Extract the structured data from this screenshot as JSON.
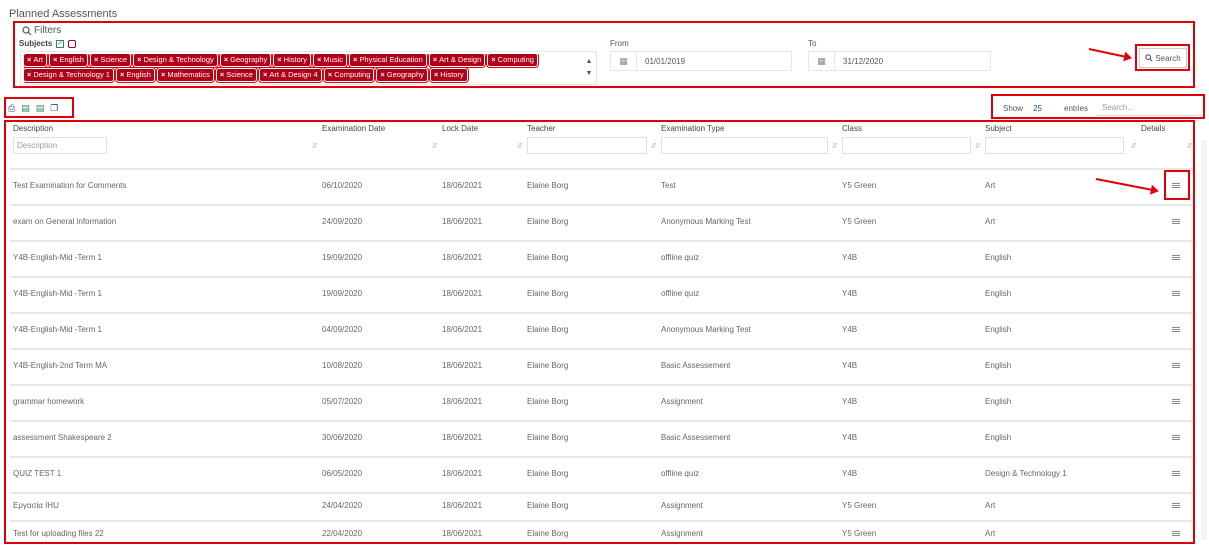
{
  "page": {
    "title": "Planned Assessments"
  },
  "filters": {
    "title": "Filters",
    "subjects_label": "Subjects",
    "tags": [
      "Art",
      "English",
      "Science",
      "Design & Technology",
      "Geography",
      "History",
      "Music",
      "Physical Education",
      "Art & Design",
      "Computing",
      "Design & Technology 1",
      "English",
      "Mathematics",
      "Science",
      "Art & Design 4",
      "Computing",
      "Geography",
      "History"
    ],
    "from_label": "From",
    "from_value": "01/01/2019",
    "to_label": "To",
    "to_value": "31/12/2020",
    "search_label": "Search"
  },
  "toolbar": {
    "icons": [
      "print-icon",
      "excel-icon",
      "csv-icon",
      "copy-icon"
    ],
    "show_label": "Show",
    "show_value": "25",
    "entries_label": "entries",
    "search_placeholder": "Search..."
  },
  "table": {
    "columns": [
      "Description",
      "Examination Date",
      "Lock Date",
      "Teacher",
      "Examination Type",
      "Class",
      "Subject",
      "Details"
    ],
    "description_filter_placeholder": "Description",
    "rows": [
      [
        "Test Examination for Comments",
        "06/10/2020",
        "18/06/2021",
        "Elaine Borg",
        "Test",
        "Y5 Green",
        "Art"
      ],
      [
        "exam on General information",
        "24/09/2020",
        "18/06/2021",
        "Elaine Borg",
        "Anonymous Marking Test",
        "Y5 Green",
        "Art"
      ],
      [
        "Y4B-English-Mid -Term 1",
        "19/09/2020",
        "18/06/2021",
        "Elaine Borg",
        "offline quiz",
        "Y4B",
        "English"
      ],
      [
        "Y4B-English-Mid -Term 1",
        "19/09/2020",
        "18/06/2021",
        "Elaine Borg",
        "offline quiz",
        "Y4B",
        "English"
      ],
      [
        "Y4B-English-Mid -Term 1",
        "04/09/2020",
        "18/06/2021",
        "Elaine Borg",
        "Anonymous Marking Test",
        "Y4B",
        "English"
      ],
      [
        "Y4B-English-2nd Term MA",
        "10/08/2020",
        "18/06/2021",
        "Elaine Borg",
        "Basic Assessement",
        "Y4B",
        "English"
      ],
      [
        "grammar homework",
        "05/07/2020",
        "18/06/2021",
        "Elaine Borg",
        "Assignment",
        "Y4B",
        "English"
      ],
      [
        "assessment Shakespeare 2",
        "30/06/2020",
        "18/06/2021",
        "Elaine Borg",
        "Basic Assessement",
        "Y4B",
        "English"
      ],
      [
        "QUIZ TEST 1",
        "06/05/2020",
        "18/06/2021",
        "Elaine Borg",
        "offline quiz",
        "Y4B",
        "Design & Technology 1"
      ],
      [
        "Εργασία IHU",
        "24/04/2020",
        "18/06/2021",
        "Elaine Borg",
        "Assignment",
        "Y5 Green",
        "Art"
      ],
      [
        "Test for uploading files 22",
        "22/04/2020",
        "18/06/2021",
        "Elaine Borg",
        "Assignment",
        "Y5 Green",
        "Art"
      ]
    ]
  },
  "colors": {
    "tag_bg": "#b0001a",
    "highlight": "#e0000a",
    "link": "#1d4e8f"
  }
}
